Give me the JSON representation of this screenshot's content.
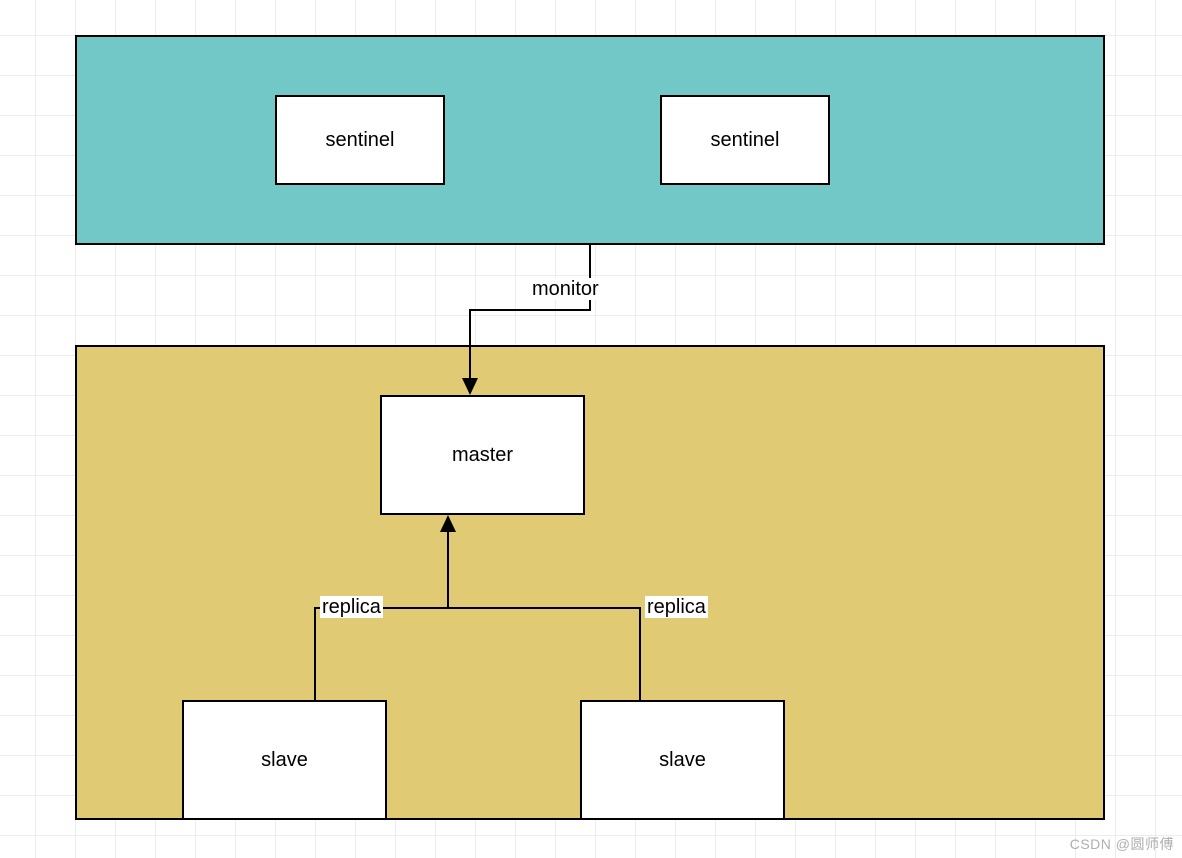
{
  "colors": {
    "teal": "#72c7c7",
    "tan": "#e0ca74",
    "white": "#ffffff",
    "black": "#000000"
  },
  "panels": {
    "top": {
      "name": "sentinel-panel"
    },
    "bottom": {
      "name": "cluster-panel"
    }
  },
  "nodes": {
    "sentinel1": {
      "label": "sentinel"
    },
    "sentinel2": {
      "label": "sentinel"
    },
    "master": {
      "label": "master"
    },
    "slave1": {
      "label": "slave"
    },
    "slave2": {
      "label": "slave"
    }
  },
  "edges": {
    "monitor": {
      "label": "monitor"
    },
    "replica1": {
      "label": "replica"
    },
    "replica2": {
      "label": "replica"
    }
  },
  "watermark": "CSDN @圆师傅"
}
